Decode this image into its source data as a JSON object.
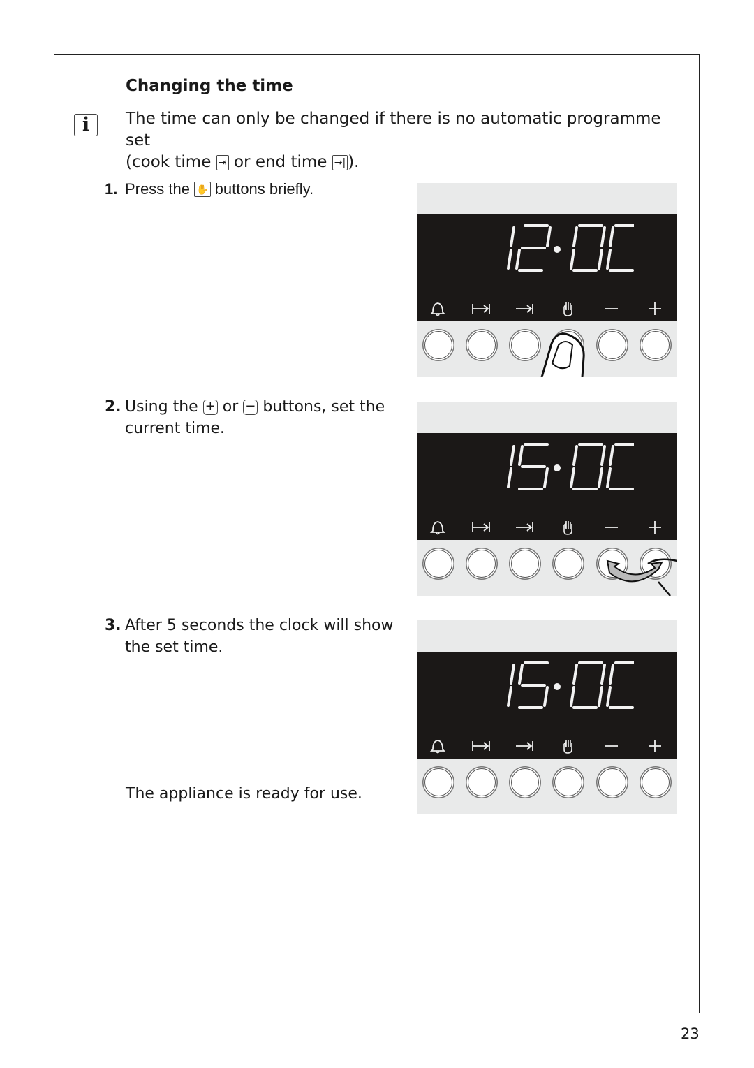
{
  "heading": "Changing the time",
  "intro": {
    "text1": "The time can only be changed if there is no automatic programme set",
    "text2": "(cook time",
    "text3": "or end time",
    "text4": ")."
  },
  "info_icon": "i",
  "steps": [
    {
      "num": "1.",
      "a": "Press the",
      "b": "buttons briefly."
    },
    {
      "num": "2.",
      "a": "Using the",
      "b": "or",
      "c": "buttons, set the",
      "d": "current time."
    },
    {
      "num": "3.",
      "a": "After 5 seconds the clock will show",
      "d": "the set time."
    }
  ],
  "ready": "The appliance is ready for use.",
  "page_number": "23",
  "panels": [
    {
      "time": "12:00",
      "action": "press-clock-button"
    },
    {
      "time": "15:00",
      "action": "press-plus-minus"
    },
    {
      "time": "15:00",
      "action": "none"
    }
  ],
  "button_labels": [
    "bell",
    "cook-time",
    "end-time",
    "clock",
    "minus",
    "plus"
  ]
}
